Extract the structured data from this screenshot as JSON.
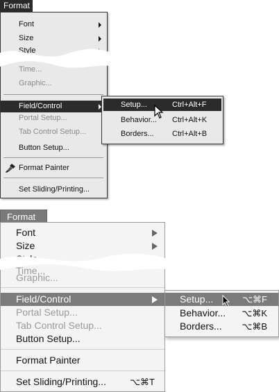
{
  "windows_menu": {
    "title": "Format",
    "items": [
      {
        "label": "Font",
        "state": "enabled",
        "submenu": true
      },
      {
        "label": "Size",
        "state": "enabled",
        "submenu": true
      },
      {
        "label": "Style",
        "state": "enabled",
        "submenu": true
      },
      {
        "label": "Time...",
        "state": "disabled",
        "submenu": false
      },
      {
        "label": "Graphic...",
        "state": "disabled",
        "submenu": false
      },
      {
        "label": "Field/Control",
        "state": "highlighted",
        "submenu": true
      },
      {
        "label": "Portal Setup...",
        "state": "disabled",
        "submenu": false
      },
      {
        "label": "Tab Control Setup...",
        "state": "disabled",
        "submenu": false
      },
      {
        "label": "Button Setup...",
        "state": "enabled",
        "submenu": false
      },
      {
        "label": "Format Painter",
        "state": "enabled",
        "submenu": false,
        "icon": "paintbrush-icon"
      },
      {
        "label": "Set Sliding/Printing...",
        "state": "enabled",
        "submenu": false
      }
    ],
    "submenu": [
      {
        "label": "Setup...",
        "shortcut": "Ctrl+Alt+F",
        "state": "highlighted"
      },
      {
        "label": "Behavior...",
        "shortcut": "Ctrl+Alt+K",
        "state": "enabled"
      },
      {
        "label": "Borders...",
        "shortcut": "Ctrl+Alt+B",
        "state": "enabled"
      }
    ]
  },
  "mac_menu": {
    "title": "Format",
    "items": [
      {
        "label": "Font",
        "state": "enabled",
        "submenu": true
      },
      {
        "label": "Size",
        "state": "enabled",
        "submenu": true
      },
      {
        "label": "Style",
        "state": "enabled",
        "submenu": true
      },
      {
        "label": "Time...",
        "state": "disabled",
        "submenu": false
      },
      {
        "label": "Graphic...",
        "state": "disabled",
        "submenu": false
      },
      {
        "label": "Field/Control",
        "state": "highlighted",
        "submenu": true
      },
      {
        "label": "Portal Setup...",
        "state": "disabled",
        "submenu": false
      },
      {
        "label": "Tab Control Setup...",
        "state": "disabled",
        "submenu": false
      },
      {
        "label": "Button Setup...",
        "state": "enabled",
        "submenu": false
      },
      {
        "label": "Format Painter",
        "state": "enabled",
        "submenu": false
      },
      {
        "label": "Set Sliding/Printing...",
        "state": "enabled",
        "submenu": false,
        "shortcut": "⌥⌘T"
      }
    ],
    "submenu": [
      {
        "label": "Setup...",
        "shortcut": "⌥⌘F",
        "state": "highlighted"
      },
      {
        "label": "Behavior...",
        "shortcut": "⌥⌘K",
        "state": "enabled"
      },
      {
        "label": "Borders...",
        "shortcut": "⌥⌘B",
        "state": "enabled"
      }
    ]
  }
}
